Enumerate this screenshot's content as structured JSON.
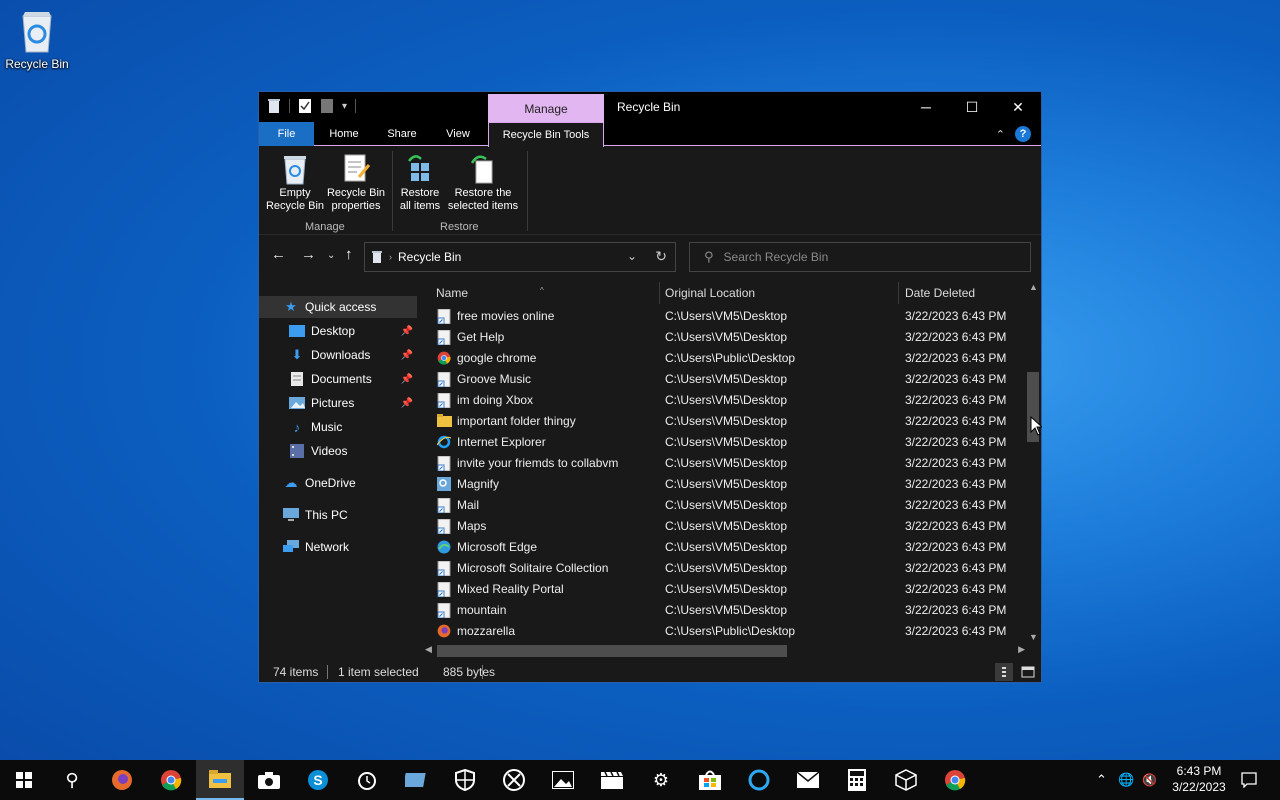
{
  "desktop": {
    "recycle_bin_label": "Recycle Bin"
  },
  "window": {
    "title": "Recycle Bin",
    "context_tab_group": "Manage",
    "tabs": {
      "file": "File",
      "home": "Home",
      "share": "Share",
      "view": "View",
      "recycle_bin_tools": "Recycle Bin Tools"
    },
    "ribbon": {
      "empty_line1": "Empty",
      "empty_line2": "Recycle Bin",
      "props_line1": "Recycle Bin",
      "props_line2": "properties",
      "restore_all_line1": "Restore",
      "restore_all_line2": "all items",
      "restore_sel_line1": "Restore the",
      "restore_sel_line2": "selected items",
      "group_manage": "Manage",
      "group_restore": "Restore"
    },
    "address": {
      "crumb": "Recycle Bin"
    },
    "search": {
      "placeholder": "Search Recycle Bin"
    },
    "nav": {
      "quick_access": "Quick access",
      "desktop": "Desktop",
      "downloads": "Downloads",
      "documents": "Documents",
      "pictures": "Pictures",
      "music": "Music",
      "videos": "Videos",
      "onedrive": "OneDrive",
      "this_pc": "This PC",
      "network": "Network"
    },
    "columns": {
      "name": "Name",
      "location": "Original Location",
      "date": "Date Deleted"
    },
    "files": [
      {
        "name": "free movies online",
        "location": "C:\\Users\\VM5\\Desktop",
        "date": "3/22/2023 6:43 PM",
        "icon": "shortcut-icon"
      },
      {
        "name": "Get Help",
        "location": "C:\\Users\\VM5\\Desktop",
        "date": "3/22/2023 6:43 PM",
        "icon": "shortcut-icon"
      },
      {
        "name": "google chrome",
        "location": "C:\\Users\\Public\\Desktop",
        "date": "3/22/2023 6:43 PM",
        "icon": "chrome-icon"
      },
      {
        "name": "Groove Music",
        "location": "C:\\Users\\VM5\\Desktop",
        "date": "3/22/2023 6:43 PM",
        "icon": "shortcut-icon"
      },
      {
        "name": "im doing Xbox",
        "location": "C:\\Users\\VM5\\Desktop",
        "date": "3/22/2023 6:43 PM",
        "icon": "shortcut-icon"
      },
      {
        "name": "important folder thingy",
        "location": "C:\\Users\\VM5\\Desktop",
        "date": "3/22/2023 6:43 PM",
        "icon": "folder-icon"
      },
      {
        "name": "Internet Explorer",
        "location": "C:\\Users\\VM5\\Desktop",
        "date": "3/22/2023 6:43 PM",
        "icon": "ie-icon"
      },
      {
        "name": "invite your friemds to collabvm",
        "location": "C:\\Users\\VM5\\Desktop",
        "date": "3/22/2023 6:43 PM",
        "icon": "shortcut-icon"
      },
      {
        "name": "Magnify",
        "location": "C:\\Users\\VM5\\Desktop",
        "date": "3/22/2023 6:43 PM",
        "icon": "magnify-icon"
      },
      {
        "name": "Mail",
        "location": "C:\\Users\\VM5\\Desktop",
        "date": "3/22/2023 6:43 PM",
        "icon": "shortcut-icon"
      },
      {
        "name": "Maps",
        "location": "C:\\Users\\VM5\\Desktop",
        "date": "3/22/2023 6:43 PM",
        "icon": "shortcut-icon"
      },
      {
        "name": "Microsoft Edge",
        "location": "C:\\Users\\VM5\\Desktop",
        "date": "3/22/2023 6:43 PM",
        "icon": "edge-icon"
      },
      {
        "name": "Microsoft Solitaire Collection",
        "location": "C:\\Users\\VM5\\Desktop",
        "date": "3/22/2023 6:43 PM",
        "icon": "shortcut-icon"
      },
      {
        "name": "Mixed Reality Portal",
        "location": "C:\\Users\\VM5\\Desktop",
        "date": "3/22/2023 6:43 PM",
        "icon": "shortcut-icon"
      },
      {
        "name": "mountain",
        "location": "C:\\Users\\VM5\\Desktop",
        "date": "3/22/2023 6:43 PM",
        "icon": "shortcut-icon"
      },
      {
        "name": "mozzarella",
        "location": "C:\\Users\\Public\\Desktop",
        "date": "3/22/2023 6:43 PM",
        "icon": "firefox-icon"
      }
    ],
    "status": {
      "count": "74 items",
      "selection": "1 item selected",
      "size": "885 bytes"
    }
  },
  "taskbar": {
    "clock_time": "6:43 PM",
    "clock_date": "3/22/2023"
  }
}
